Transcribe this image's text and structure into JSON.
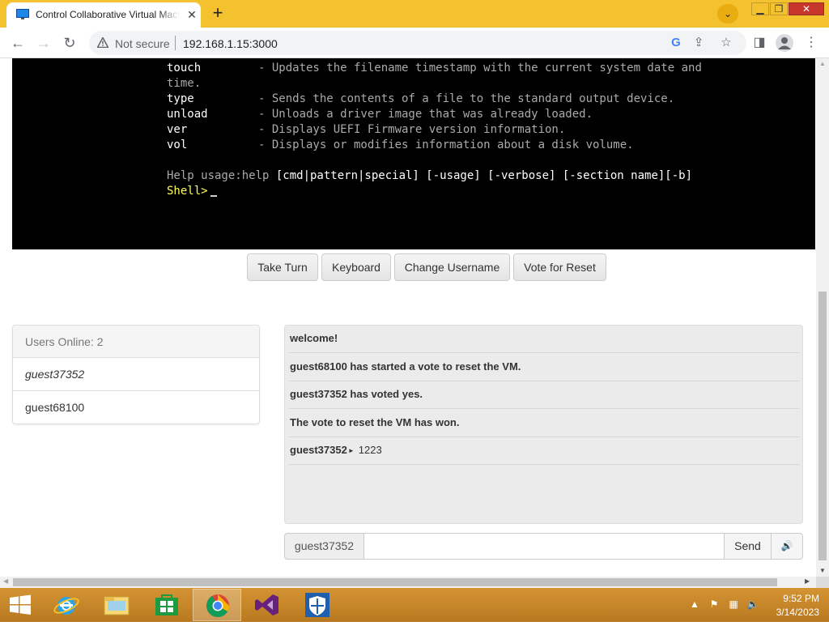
{
  "browser": {
    "tab_title": "Control Collaborative Virtual Machine",
    "url_warning": "Not secure",
    "url": "192.168.1.15:3000"
  },
  "terminal": {
    "lines": [
      {
        "cmd": "touch",
        "desc": "- Updates the filename timestamp with the current system date and"
      },
      {
        "cmd": "",
        "desc": "time."
      },
      {
        "cmd": "type",
        "desc": "- Sends the contents of a file to the standard output device."
      },
      {
        "cmd": "unload",
        "desc": "- Unloads a driver image that was already loaded."
      },
      {
        "cmd": "ver",
        "desc": "- Displays UEFI Firmware version information."
      },
      {
        "cmd": "vol",
        "desc": "- Displays or modifies information about a disk volume."
      }
    ],
    "help_prefix": "Help usage:help ",
    "help_args": "[cmd|pattern|special] [-usage] [-verbose] [-section name][-b]",
    "prompt": "Shell>"
  },
  "vm_buttons": {
    "take_turn": "Take Turn",
    "keyboard": "Keyboard",
    "change_username": "Change Username",
    "vote_reset": "Vote for Reset"
  },
  "users": {
    "header": "Users Online: 2",
    "list": [
      "guest37352",
      "guest68100"
    ]
  },
  "chat": {
    "messages": [
      {
        "text": "welcome!"
      },
      {
        "text": "guest68100 has started a vote to reset the VM."
      },
      {
        "text": "guest37352 has voted yes."
      },
      {
        "text": "The vote to reset the VM has won."
      },
      {
        "user": "guest37352",
        "arrow": "►",
        "text": "1223"
      }
    ],
    "username": "guest37352",
    "input_value": "",
    "send_label": "Send"
  },
  "taskbar": {
    "time": "9:52 PM",
    "date": "3/14/2023"
  },
  "colors": {
    "taskbar": "#c8892c",
    "tab_strip": "#f4c12f",
    "terminal_bg": "#000000",
    "terminal_prompt": "#ffff55"
  }
}
